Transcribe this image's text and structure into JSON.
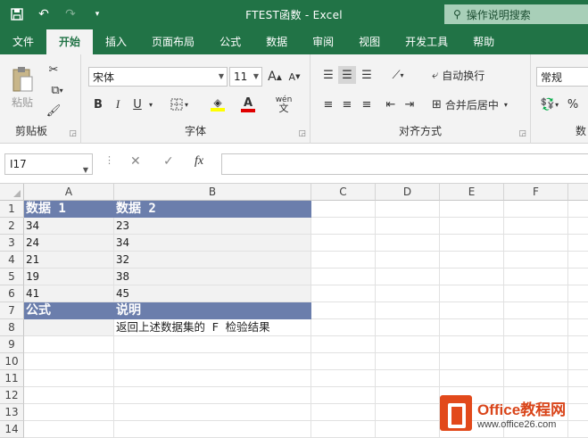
{
  "title_bar": {
    "title": "FTEST函数 - Excel",
    "tell_me": "操作说明搜索"
  },
  "tabs": [
    {
      "label": "文件",
      "active": false
    },
    {
      "label": "开始",
      "active": true
    },
    {
      "label": "插入",
      "active": false
    },
    {
      "label": "页面布局",
      "active": false
    },
    {
      "label": "公式",
      "active": false
    },
    {
      "label": "数据",
      "active": false
    },
    {
      "label": "审阅",
      "active": false
    },
    {
      "label": "视图",
      "active": false
    },
    {
      "label": "开发工具",
      "active": false
    },
    {
      "label": "帮助",
      "active": false
    }
  ],
  "ribbon": {
    "clipboard": {
      "label": "剪贴板",
      "paste": "粘贴"
    },
    "font": {
      "label": "字体",
      "name": "宋体",
      "size": "11",
      "bold": "B",
      "italic": "I",
      "underline": "U",
      "grow": "A",
      "shrink": "A"
    },
    "alignment": {
      "label": "对齐方式",
      "wrap": "自动换行",
      "merge": "合并后居中"
    },
    "number": {
      "label": "数",
      "format": "常规",
      "percent": "%"
    }
  },
  "formula_bar": {
    "name_box": "I17",
    "fx": "fx",
    "formula": ""
  },
  "grid": {
    "columns": [
      "A",
      "B",
      "C",
      "D",
      "E",
      "F"
    ],
    "rows": [
      "1",
      "2",
      "3",
      "4",
      "5",
      "6",
      "7",
      "8",
      "9",
      "10",
      "11",
      "12",
      "13",
      "14"
    ],
    "cells": {
      "A1": "数据 1",
      "B1": "数据 2",
      "A2": "34",
      "B2": "23",
      "A3": "24",
      "B3": "34",
      "A4": "21",
      "B4": "32",
      "A5": "19",
      "B5": "38",
      "A6": "41",
      "B6": "45",
      "A7": "公式",
      "B7": "说明",
      "A8": "",
      "B8": "返回上述数据集的 F 检验结果"
    }
  },
  "watermark": {
    "name": "Office教程网",
    "url": "www.office26.com"
  },
  "colors": {
    "excel_green": "#217346",
    "header_fill": "#6b7eac",
    "band_fill": "#f2f2f2",
    "watermark_orange": "#e2491b"
  }
}
